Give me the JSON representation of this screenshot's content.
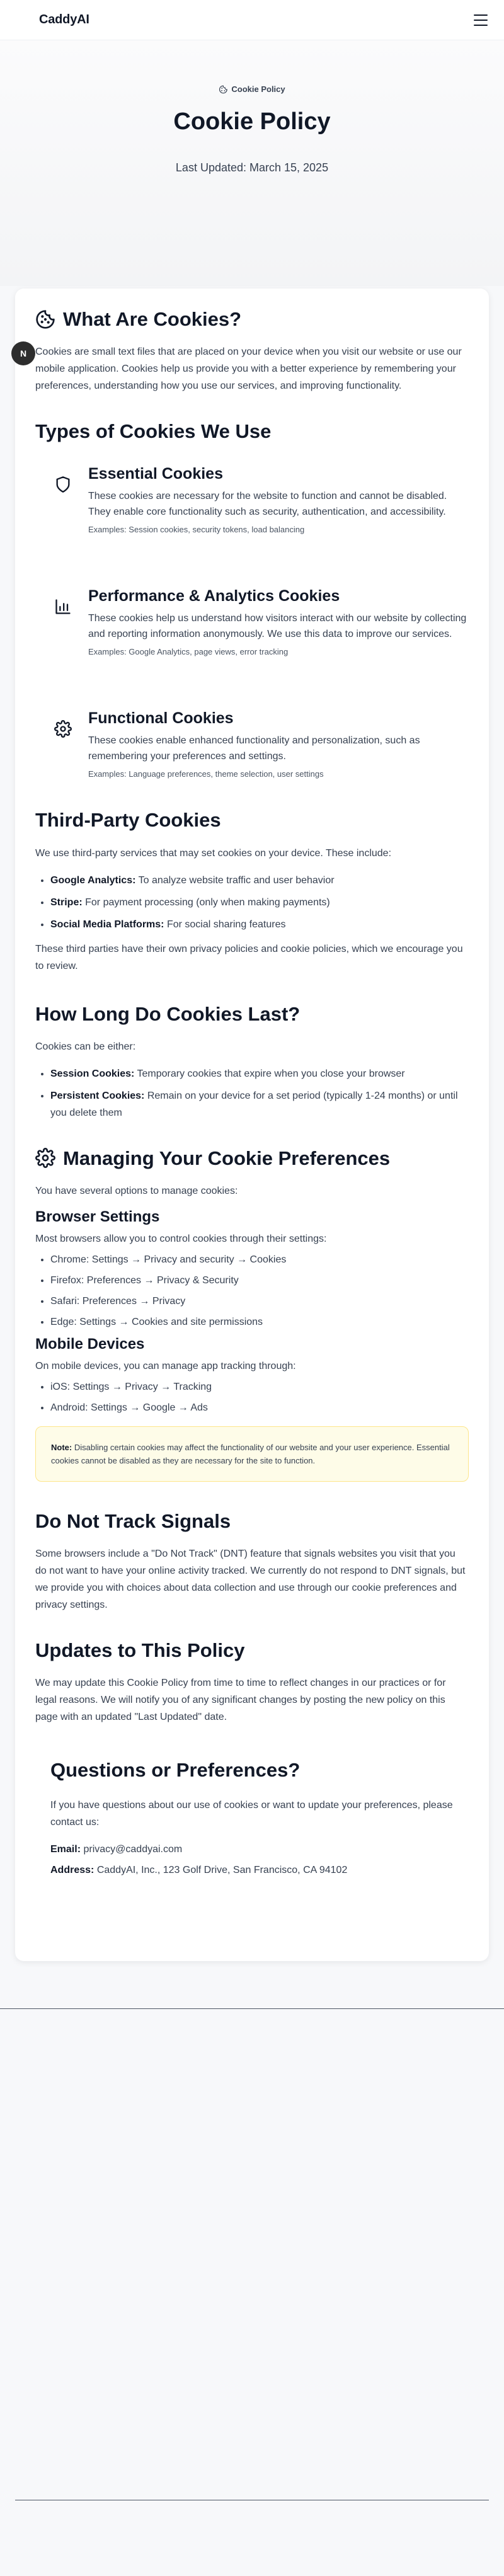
{
  "header": {
    "logo": "CaddyAI",
    "menu_icon": "menu-icon"
  },
  "hero": {
    "badge": "Cookie Policy",
    "title": "Cookie Policy",
    "updated": "Last Updated: March 15, 2025"
  },
  "avatar": {
    "initial": "N"
  },
  "what_are_cookies": {
    "heading": "What Are Cookies?",
    "body": "Cookies are small text files that are placed on your device when you visit our website or use our mobile application. Cookies help us provide you with a better experience by remembering your preferences, understanding how you use our services, and improving functionality."
  },
  "types": {
    "heading": "Types of Cookies We Use",
    "items": [
      {
        "title": "Essential Cookies",
        "body": "These cookies are necessary for the website to function and cannot be disabled. They enable core functionality such as security, authentication, and accessibility.",
        "examples": "Examples: Session cookies, security tokens, load balancing",
        "icon": "shield-icon"
      },
      {
        "title": "Performance & Analytics Cookies",
        "body": "These cookies help us understand how visitors interact with our website by collecting and reporting information anonymously. We use this data to improve our services.",
        "examples": "Examples: Google Analytics, page views, error tracking",
        "icon": "bar-chart-icon"
      },
      {
        "title": "Functional Cookies",
        "body": "These cookies enable enhanced functionality and personalization, such as remembering your preferences and settings.",
        "examples": "Examples: Language preferences, theme selection, user settings",
        "icon": "gear-icon"
      }
    ]
  },
  "third_party": {
    "heading": "Third-Party Cookies",
    "intro": "We use third-party services that may set cookies on your device. These include:",
    "items": [
      {
        "label": "Google Analytics:",
        "text": " To analyze website traffic and user behavior"
      },
      {
        "label": "Stripe:",
        "text": " For payment processing (only when making payments)"
      },
      {
        "label": "Social Media Platforms:",
        "text": " For social sharing features"
      }
    ],
    "outro": "These third parties have their own privacy policies and cookie policies, which we encourage you to review."
  },
  "duration": {
    "heading": "How Long Do Cookies Last?",
    "intro": "Cookies can be either:",
    "items": [
      {
        "label": "Session Cookies:",
        "text": " Temporary cookies that expire when you close your browser"
      },
      {
        "label": "Persistent Cookies:",
        "text": " Remain on your device for a set period (typically 1-24 months) or until you delete them"
      }
    ]
  },
  "managing": {
    "heading": "Managing Your Cookie Preferences",
    "intro": "You have several options to manage cookies:",
    "browser": {
      "heading": "Browser Settings",
      "intro": "Most browsers allow you to control cookies through their settings:",
      "items": [
        "Chrome: Settings → Privacy and security → Cookies",
        "Firefox: Preferences → Privacy & Security",
        "Safari: Preferences → Privacy",
        "Edge: Settings → Cookies and site permissions"
      ]
    },
    "mobile": {
      "heading": "Mobile Devices",
      "intro": "On mobile devices, you can manage app tracking through:",
      "items": [
        "iOS: Settings → Privacy → Tracking",
        "Android: Settings → Google → Ads"
      ]
    },
    "note_label": "Note:",
    "note_text": " Disabling certain cookies may affect the functionality of our website and your user experience. Essential cookies cannot be disabled as they are necessary for the site to function."
  },
  "dnt": {
    "heading": "Do Not Track Signals",
    "body": "Some browsers include a \"Do Not Track\" (DNT) feature that signals websites you visit that you do not want to have your online activity tracked. We currently do not respond to DNT signals, but we provide you with choices about data collection and use through our cookie preferences and privacy settings."
  },
  "updates": {
    "heading": "Updates to This Policy",
    "body": "We may update this Cookie Policy from time to time to reflect changes in our practices or for legal reasons. We will notify you of any significant changes by posting the new policy on this page with an updated \"Last Updated\" date."
  },
  "contact": {
    "heading": "Questions or Preferences?",
    "intro": "If you have questions about our use of cookies or want to update your preferences, please contact us:",
    "email_label": "Email:",
    "email": "privacy@caddyai.com",
    "address_label": "Address:",
    "address": "CaddyAI, Inc., 123 Golf Drive, San Francisco, CA 94102"
  }
}
